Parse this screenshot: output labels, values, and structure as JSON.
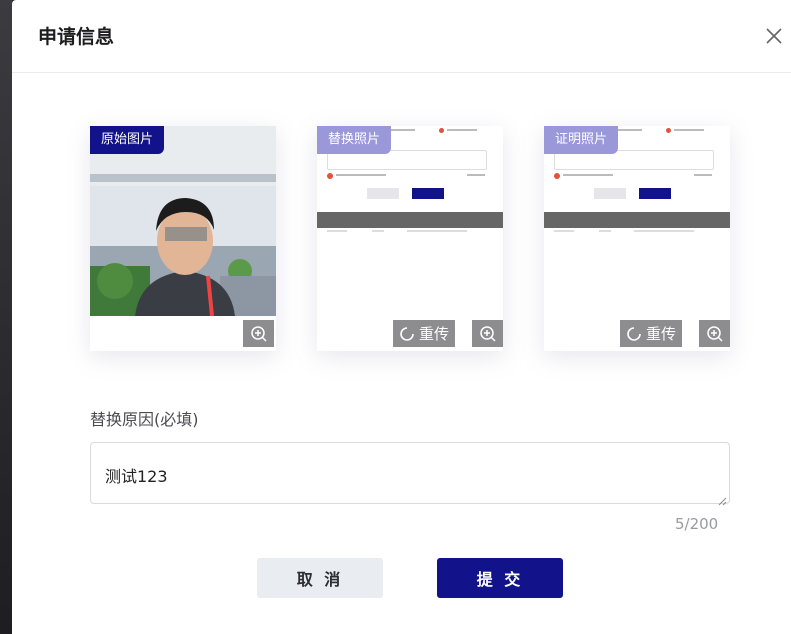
{
  "modal": {
    "title": "申请信息",
    "close_icon": "close-icon"
  },
  "cards": [
    {
      "label": "原始图片",
      "zoom_icon": "zoom-in-icon"
    },
    {
      "label": "替换照片",
      "reupload_label": "重传",
      "reupload_icon": "refresh-icon",
      "zoom_icon": "zoom-in-icon"
    },
    {
      "label": "证明照片",
      "reupload_label": "重传",
      "reupload_icon": "refresh-icon",
      "zoom_icon": "zoom-in-icon"
    }
  ],
  "reason": {
    "label": "替换原因(必填)",
    "value": "测试123",
    "counter": "5/200"
  },
  "buttons": {
    "cancel": "取 消",
    "submit": "提 交"
  },
  "colors": {
    "primary": "#12128a",
    "label_light": "#9b98d9",
    "overlay_button": "#8d8d90"
  }
}
